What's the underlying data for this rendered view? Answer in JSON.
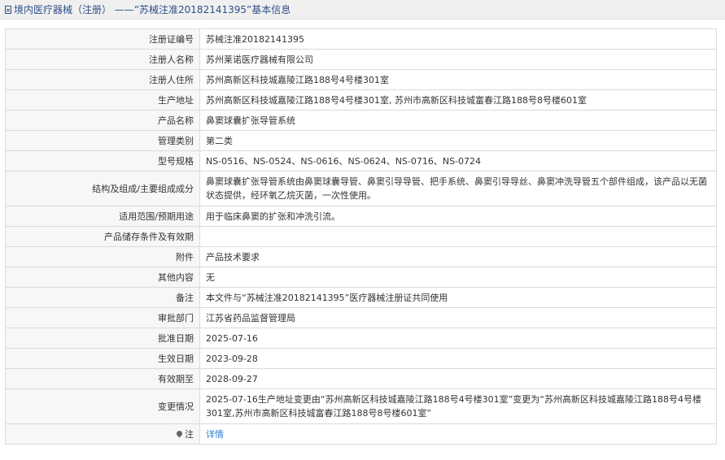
{
  "header": {
    "title": "境内医疗器械（注册） ——“苏械注准20182141395”基本信息"
  },
  "rows": [
    {
      "label": "注册证编号",
      "value": "苏械注准20182141395"
    },
    {
      "label": "注册人名称",
      "value": "苏州莱诺医疗器械有限公司"
    },
    {
      "label": "注册人住所",
      "value": "苏州高新区科技城嘉陵江路188号4号楼301室"
    },
    {
      "label": "生产地址",
      "value": "苏州高新区科技城嘉陵江路188号4号楼301室, 苏州市高新区科技城富春江路188号8号楼601室"
    },
    {
      "label": "产品名称",
      "value": "鼻窦球囊扩张导管系统"
    },
    {
      "label": "管理类别",
      "value": "第二类"
    },
    {
      "label": "型号规格",
      "value": "NS-0516、NS-0524、NS-0616、NS-0624、NS-0716、NS-0724"
    },
    {
      "label": "结构及组成/主要组成成分",
      "value": "鼻窦球囊扩张导管系统由鼻窦球囊导管、鼻窦引导导管、把手系统、鼻窦引导导丝、鼻窦冲洗导管五个部件组成，该产品以无菌状态提供，经环氧乙烷灭菌，一次性使用。"
    },
    {
      "label": "适用范围/预期用途",
      "value": "用于临床鼻窦的扩张和冲洗引流。"
    },
    {
      "label": "产品储存条件及有效期",
      "value": ""
    },
    {
      "label": "附件",
      "value": "产品技术要求"
    },
    {
      "label": "其他内容",
      "value": "无"
    },
    {
      "label": "备注",
      "value": "本文件与“苏械注准20182141395”医疗器械注册证共同使用"
    },
    {
      "label": "审批部门",
      "value": "江苏省药品监督管理局"
    },
    {
      "label": "批准日期",
      "value": "2025-07-16"
    },
    {
      "label": "生效日期",
      "value": "2023-09-28"
    },
    {
      "label": "有效期至",
      "value": "2028-09-27"
    },
    {
      "label": "变更情况",
      "value": "2025-07-16生产地址变更由“苏州高新区科技城嘉陵江路188号4号楼301室”变更为“苏州高新区科技城嘉陵江路188号4号楼301室,苏州市高新区科技城富春江路188号8号楼601室”"
    }
  ],
  "note": {
    "icon": "pin-icon",
    "label": "注",
    "link_text": "详情"
  },
  "colors": {
    "header_text": "#2e4f88",
    "label_bg": "#f7f7f7",
    "border": "#dadada",
    "link": "#2e7bd1"
  }
}
